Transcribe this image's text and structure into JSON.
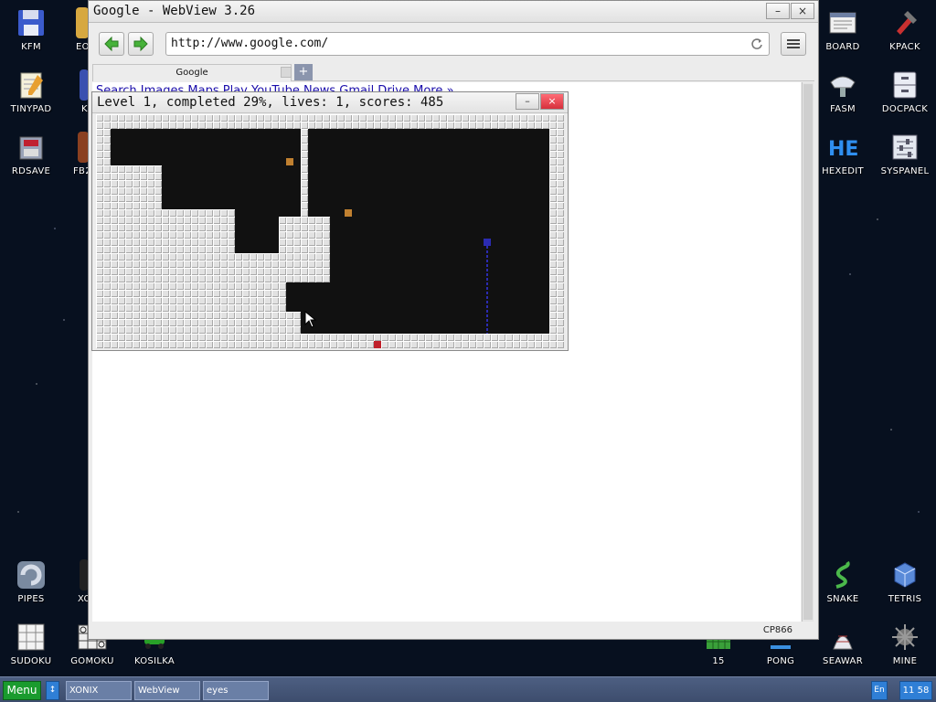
{
  "desktop": {
    "left_icons": [
      {
        "label": "KFM",
        "icon": "floppy-disk-icon"
      },
      {
        "label": "TINYPAD",
        "icon": "notepad-icon"
      },
      {
        "label": "RDSAVE",
        "icon": "ramdisk-save-icon"
      },
      {
        "label": "PIPES",
        "icon": "pipes-game-icon"
      },
      {
        "label": "SUDOKU",
        "icon": "sudoku-icon"
      }
    ],
    "second_column_icons": [
      {
        "label": "EO",
        "icon": "partial-icon"
      },
      {
        "label": "K",
        "icon": "partial-icon"
      },
      {
        "label": "FB2",
        "icon": "partial-icon"
      },
      {
        "label": "XO",
        "icon": "partial-icon"
      },
      {
        "label": "GOMOKU",
        "icon": "gomoku-icon"
      },
      {
        "label": "KOSILKA",
        "icon": "lawnmower-icon"
      }
    ],
    "right_icons": [
      {
        "label": "BOARD",
        "icon": "board-icon"
      },
      {
        "label": "KPACK",
        "icon": "kpack-icon"
      },
      {
        "label": "FASM",
        "icon": "fasm-icon"
      },
      {
        "label": "DOCPACK",
        "icon": "docpack-icon"
      },
      {
        "label": "HEXEDIT",
        "icon": "hexedit-icon"
      },
      {
        "label": "SYSPANEL",
        "icon": "syspanel-icon"
      },
      {
        "label": "SNAKE",
        "icon": "snake-icon"
      },
      {
        "label": "TETRIS",
        "icon": "tetris-icon"
      },
      {
        "label": "15",
        "icon": "fifteen-puzzle-icon"
      },
      {
        "label": "PONG",
        "icon": "pong-icon"
      },
      {
        "label": "SEAWAR",
        "icon": "seawar-icon"
      },
      {
        "label": "MINE",
        "icon": "mine-icon"
      }
    ]
  },
  "browser": {
    "title": "Google - WebView 3.26",
    "minimize_label": "–",
    "close_label": "×",
    "url": "http://www.google.com/",
    "tab_label": "Google",
    "new_tab_label": "+",
    "page_links_partial": "Search Images Maps Play YouTube News Gmail Drive More »",
    "encoding": "CP866"
  },
  "game": {
    "title": "Level 1, completed 29%, lives: 1, scores: 485",
    "minimize_label": "–",
    "close_label": "×",
    "colors": {
      "captured": "#e2e2e2",
      "open": "#111111",
      "enemy": "#c08030",
      "player": "#2b2bb0",
      "ground_enemy": "#c0202a"
    }
  },
  "taskbar": {
    "menu_label": "Menu",
    "arrow_label": "↕",
    "tasks": [
      "XONIX",
      "WebView",
      "eyes"
    ],
    "language": "En",
    "clock": "11 58"
  }
}
